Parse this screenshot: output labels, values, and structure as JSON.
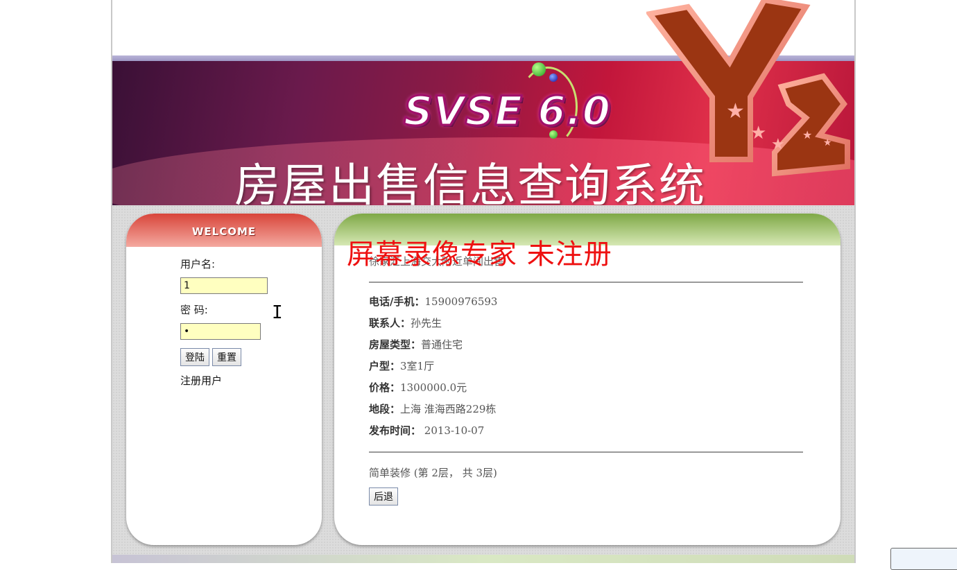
{
  "banner": {
    "logo_text": "SVSE 6.0",
    "title": "房屋出售信息查询系统",
    "badge": "Y2"
  },
  "login": {
    "header": "WELCOME",
    "username_label": "用户名:",
    "username_value": "1",
    "password_label": "密  码:",
    "password_value": "•",
    "login_button": "登陆",
    "reset_button": "重置",
    "register_link": "注册用户"
  },
  "detail": {
    "headline": "徐家汇上海交大附近单间出售",
    "rows": [
      {
        "label": "电话/手机：",
        "value": "15900976593"
      },
      {
        "label": "联系人：",
        "value": "孙先生"
      },
      {
        "label": "房屋类型：",
        "value": "普通住宅"
      },
      {
        "label": "户型：",
        "value": "3室1厅"
      },
      {
        "label": "价格：",
        "value": "1300000.0元"
      },
      {
        "label": "地段：",
        "value": "上海 淮海西路229栋"
      },
      {
        "label": "发布时间：",
        "value": " 2013-10-07"
      }
    ],
    "description": "简单装修 (第 2层， 共 3层)",
    "back_button": "后退"
  },
  "watermark": "屏幕录像专家  未注册",
  "colors": {
    "banner_accent": "#c2163b",
    "login_header": "#d8453a",
    "detail_header": "#7ea846",
    "watermark": "#ee1111"
  }
}
